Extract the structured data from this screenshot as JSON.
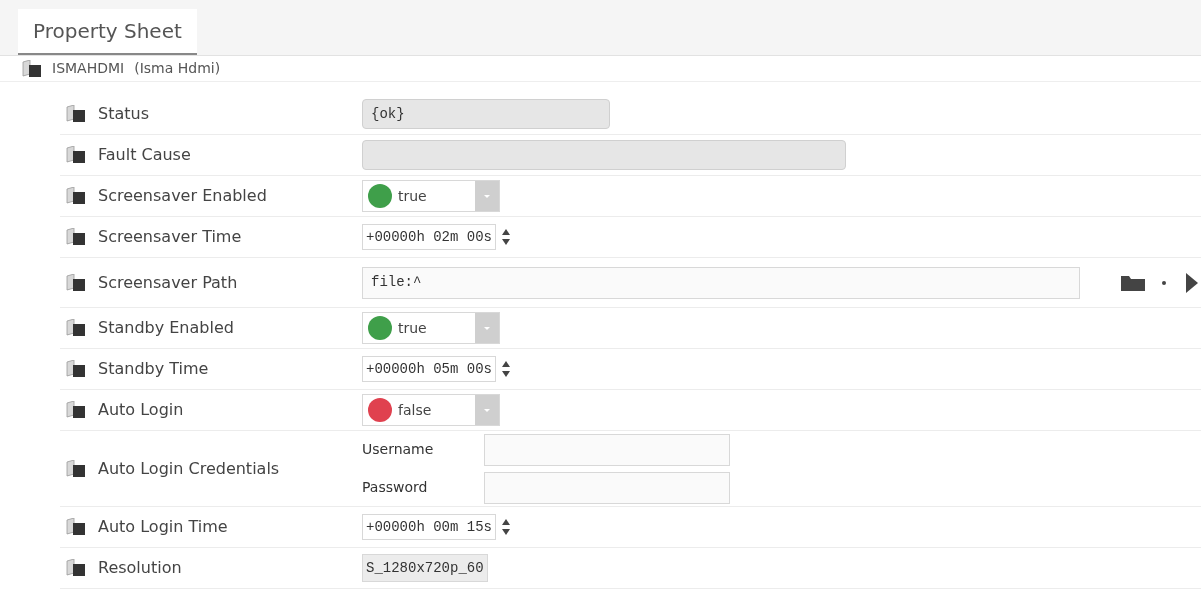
{
  "tab": {
    "label": "Property Sheet",
    "selected": true
  },
  "root": {
    "name": "ISMAHDMI",
    "type": "(Isma Hdmi)"
  },
  "properties": [
    {
      "kind": "status",
      "label": "Status",
      "value": "{ok}"
    },
    {
      "kind": "text",
      "label": "Fault Cause"
    },
    {
      "kind": "bool",
      "label": "Screensaver Enabled",
      "value": "true",
      "on": true
    },
    {
      "kind": "time",
      "label": "Screensaver Time",
      "value": "+00000h 02m 00s"
    },
    {
      "kind": "ord",
      "label": "Screensaver Path",
      "value": "file:^"
    },
    {
      "kind": "bool",
      "label": "Standby Enabled",
      "value": "true",
      "on": true
    },
    {
      "kind": "time",
      "label": "Standby Time",
      "value": "+00000h 05m 00s"
    },
    {
      "kind": "bool",
      "label": "Auto Login",
      "value": "false",
      "on": false
    },
    {
      "kind": "credentials",
      "label": "Auto Login Credentials",
      "fields": [
        "Username",
        "Password"
      ]
    },
    {
      "kind": "time",
      "label": "Auto Login Time",
      "value": "+00000h 00m 15s"
    },
    {
      "kind": "enum",
      "label": "Resolution",
      "value": "S_1280x720p_60"
    }
  ]
}
